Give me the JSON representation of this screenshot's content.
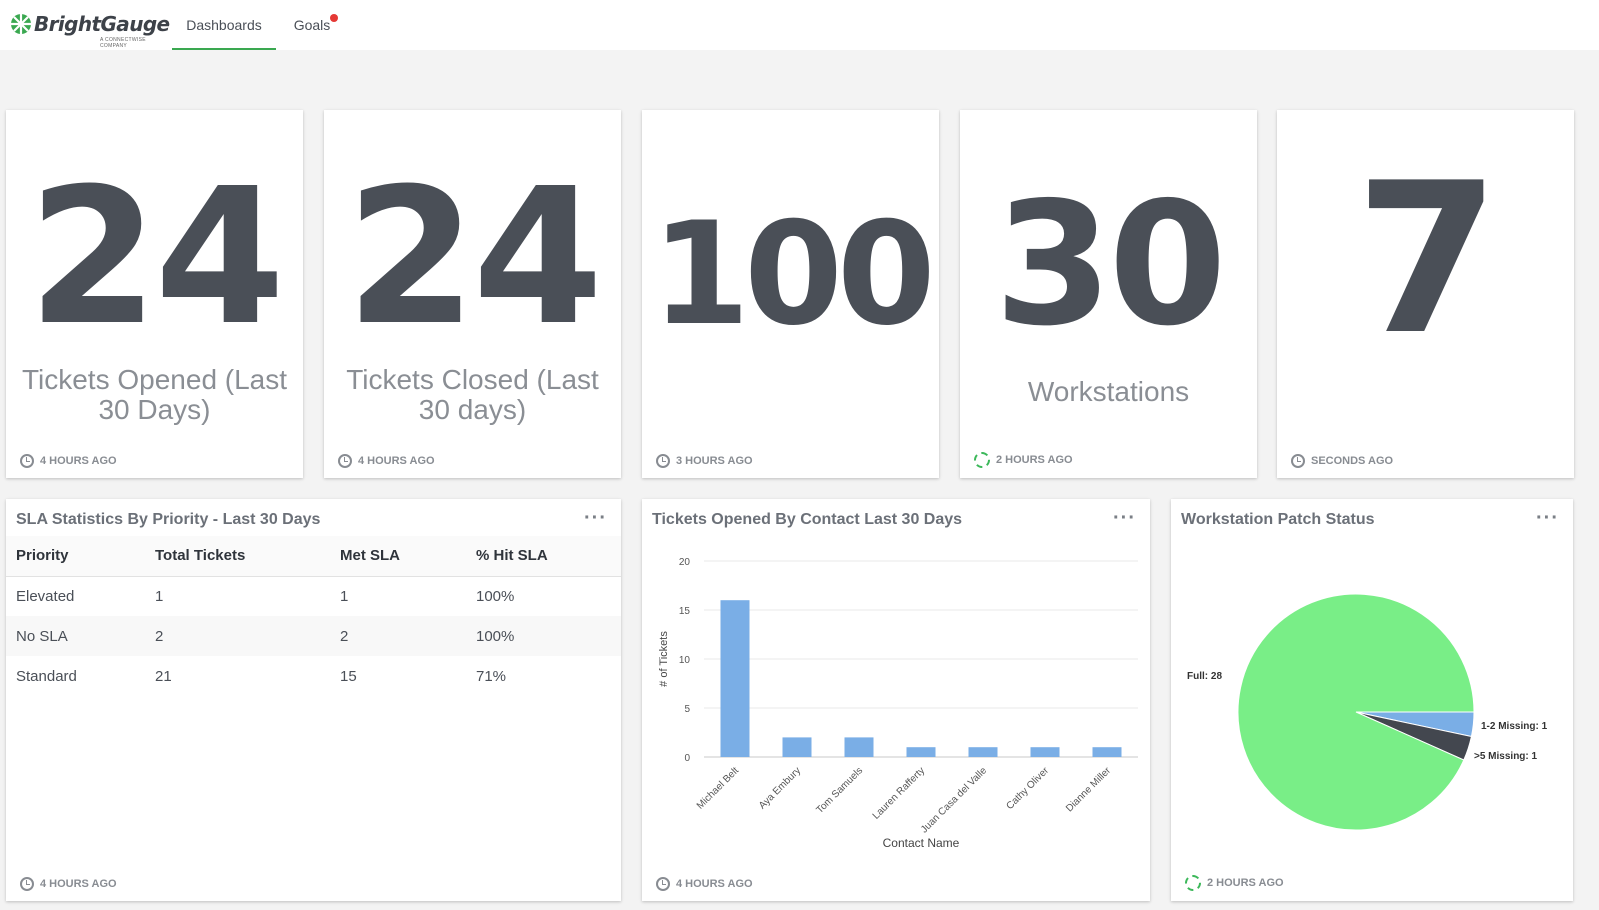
{
  "app": {
    "logo_text": "BrightGauge",
    "logo_sub": "A CONNECTWISE COMPANY"
  },
  "nav": {
    "tabs": [
      {
        "label": "Dashboards",
        "active": true
      },
      {
        "label": "Goals",
        "has_notification": true
      }
    ]
  },
  "number_cards": [
    {
      "value": "24",
      "label": "Tickets Opened (Last 30 Days)",
      "updated": "4 HOURS AGO",
      "status_icon": "clock-icon"
    },
    {
      "value": "24",
      "label": "Tickets Closed (Last 30 days)",
      "updated": "4 HOURS AGO",
      "status_icon": "clock-icon"
    },
    {
      "value": "100",
      "label": "",
      "updated": "3 HOURS AGO",
      "status_icon": "clock-icon"
    },
    {
      "value": "30",
      "label": "Workstations",
      "updated": "2 HOURS AGO",
      "status_icon": "refresh-icon"
    },
    {
      "value": "7",
      "label": "",
      "updated": "SECONDS AGO",
      "status_icon": "clock-icon"
    }
  ],
  "sla_table": {
    "title": "SLA Statistics By Priority - Last 30 Days",
    "menu": "···",
    "columns": [
      "Priority",
      "Total Tickets",
      "Met SLA",
      "% Hit SLA"
    ],
    "rows": [
      [
        "Elevated",
        "1",
        "1",
        "100%"
      ],
      [
        "No SLA",
        "2",
        "2",
        "100%"
      ],
      [
        "Standard",
        "21",
        "15",
        "71%"
      ]
    ],
    "updated": "4 HOURS AGO"
  },
  "bar_panel": {
    "title": "Tickets Opened By Contact Last 30 Days",
    "menu": "···",
    "updated": "4 HOURS AGO"
  },
  "pie_panel": {
    "title": "Workstation Patch Status",
    "menu": "···",
    "updated": "2 HOURS AGO"
  },
  "colors": {
    "accent_green": "#3aa850",
    "bar_blue": "#7aaee6",
    "pie_green": "#79ee87",
    "pie_blue": "#7aaee6",
    "pie_dark": "#43474f"
  },
  "chart_data": [
    {
      "type": "bar",
      "categories": [
        "Michael Belt",
        "Aya Embury",
        "Tom Samuels",
        "Lauren Rafferty",
        "Juan Casa del Valle",
        "Cathy Oliver",
        "Dianne Miller"
      ],
      "values": [
        16,
        2,
        2,
        1,
        1,
        1,
        1
      ],
      "title": "Tickets Opened By Contact Last 30 Days",
      "xlabel": "Contact Name",
      "ylabel": "# of Tickets",
      "ylim": [
        0,
        20
      ],
      "yticks": [
        0,
        5,
        10,
        15,
        20
      ],
      "grid": true
    },
    {
      "type": "pie",
      "title": "Workstation Patch Status",
      "labels": [
        "Full: 28",
        "1-2 Missing: 1",
        ">5 Missing: 1"
      ],
      "values": [
        28,
        1,
        1
      ]
    }
  ]
}
